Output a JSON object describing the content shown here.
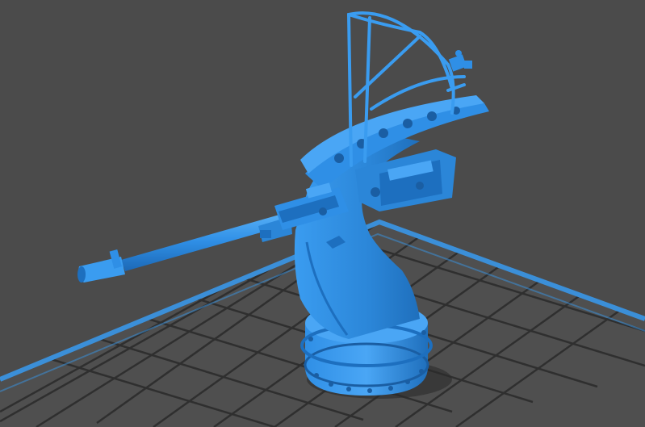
{
  "scene": {
    "kind": "3d-model-viewport",
    "object_icon": "anti-aircraft-gun-model-icon",
    "colors": {
      "background": "#4b4b4b",
      "grid_line": "#2f2f2f",
      "grid_cell": "#555555",
      "build_plate_border": "#3b8fd8",
      "model_main": "#2f8fe6",
      "model_light": "#4aa6f5",
      "model_dark": "#1d6fbf",
      "model_shadow": "#1a5ea3"
    }
  }
}
